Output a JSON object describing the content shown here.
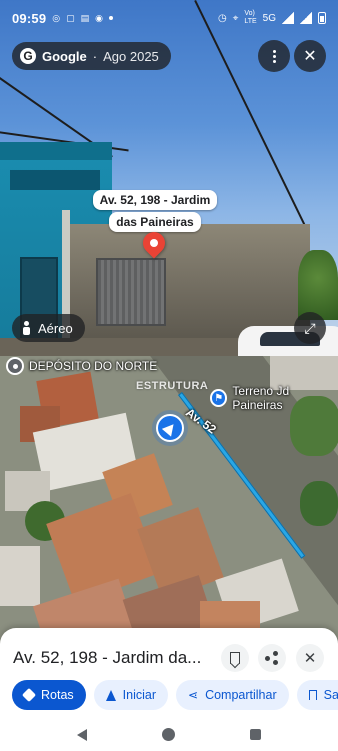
{
  "status_bar": {
    "time": "09:59",
    "left_icons": [
      "whatsapp-icon",
      "instagram-icon",
      "tim-ads-icon",
      "game-controller-icon",
      "notification-dot"
    ],
    "network_label_top": "Vo)",
    "network_label_bottom": "LTE",
    "network_type": "5G"
  },
  "street_view": {
    "brand": "Google",
    "date": "Ago 2025",
    "address_callout_line1": "Av. 52, 198 - Jardim",
    "address_callout_line2": "das Paineiras",
    "aereo_label": "Aéreo"
  },
  "map": {
    "poi_left": "DEPÓSITO DO NORTE",
    "poi_right": "Terreno Jd Paineiras",
    "street_name": "Av. 52",
    "watermark": "ESTRUTURA",
    "route_color": "#29a7e6",
    "location_color": "#1a73e8"
  },
  "sheet": {
    "title": "Av. 52, 198 - Jardim da...",
    "actions": {
      "routes": "Rotas",
      "start": "Iniciar",
      "share": "Compartilhar",
      "save": "Sal"
    }
  },
  "colors": {
    "primary": "#0b57d0",
    "chip_bg": "#e8f0fe",
    "pin": "#ea4335"
  }
}
